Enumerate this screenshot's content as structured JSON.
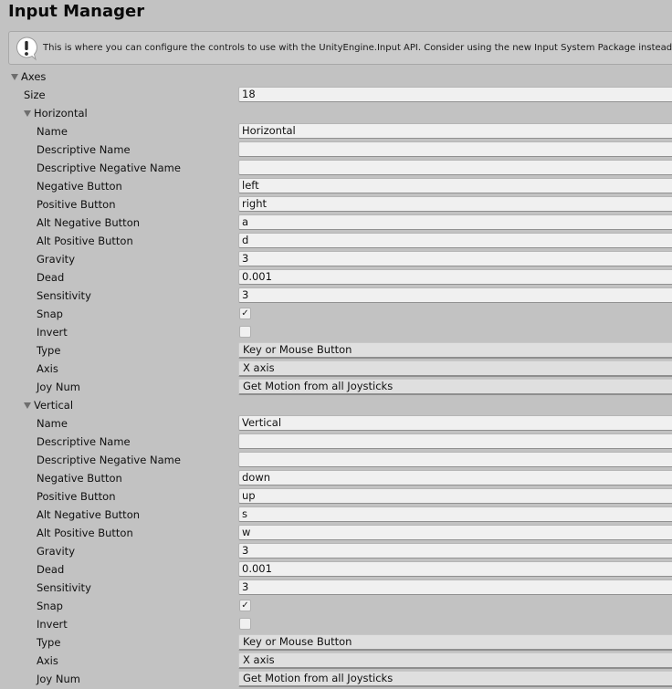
{
  "header": {
    "title": "Input Manager"
  },
  "help": {
    "icon": "warning-bubble-icon",
    "message": "This is where you can configure the controls to use with the UnityEngine.Input API. Consider using the new Input System Package instead."
  },
  "axes": {
    "label": "Axes",
    "size_label": "Size",
    "size_value": "18",
    "entries": [
      {
        "foldout_label": "Horizontal",
        "expanded": true,
        "fields": {
          "name": {
            "label": "Name",
            "value": "Horizontal"
          },
          "descriptive_name": {
            "label": "Descriptive Name",
            "value": ""
          },
          "descriptive_negative_name": {
            "label": "Descriptive Negative Name",
            "value": ""
          },
          "negative_button": {
            "label": "Negative Button",
            "value": "left"
          },
          "positive_button": {
            "label": "Positive Button",
            "value": "right"
          },
          "alt_negative_button": {
            "label": "Alt Negative Button",
            "value": "a"
          },
          "alt_positive_button": {
            "label": "Alt Positive Button",
            "value": "d"
          },
          "gravity": {
            "label": "Gravity",
            "value": "3"
          },
          "dead": {
            "label": "Dead",
            "value": "0.001"
          },
          "sensitivity": {
            "label": "Sensitivity",
            "value": "3"
          },
          "snap": {
            "label": "Snap",
            "checked": true,
            "mark": "✓"
          },
          "invert": {
            "label": "Invert",
            "checked": false,
            "mark": ""
          },
          "type": {
            "label": "Type",
            "value": "Key or Mouse Button"
          },
          "axis": {
            "label": "Axis",
            "value": "X axis"
          },
          "joy_num": {
            "label": "Joy Num",
            "value": "Get Motion from all Joysticks"
          }
        }
      },
      {
        "foldout_label": "Vertical",
        "expanded": true,
        "fields": {
          "name": {
            "label": "Name",
            "value": "Vertical"
          },
          "descriptive_name": {
            "label": "Descriptive Name",
            "value": ""
          },
          "descriptive_negative_name": {
            "label": "Descriptive Negative Name",
            "value": ""
          },
          "negative_button": {
            "label": "Negative Button",
            "value": "down"
          },
          "positive_button": {
            "label": "Positive Button",
            "value": "up"
          },
          "alt_negative_button": {
            "label": "Alt Negative Button",
            "value": "s"
          },
          "alt_positive_button": {
            "label": "Alt Positive Button",
            "value": "w"
          },
          "gravity": {
            "label": "Gravity",
            "value": "3"
          },
          "dead": {
            "label": "Dead",
            "value": "0.001"
          },
          "sensitivity": {
            "label": "Sensitivity",
            "value": "3"
          },
          "snap": {
            "label": "Snap",
            "checked": true,
            "mark": "✓"
          },
          "invert": {
            "label": "Invert",
            "checked": false,
            "mark": ""
          },
          "type": {
            "label": "Type",
            "value": "Key or Mouse Button"
          },
          "axis": {
            "label": "Axis",
            "value": "X axis"
          },
          "joy_num": {
            "label": "Joy Num",
            "value": "Get Motion from all Joysticks"
          }
        }
      }
    ]
  }
}
